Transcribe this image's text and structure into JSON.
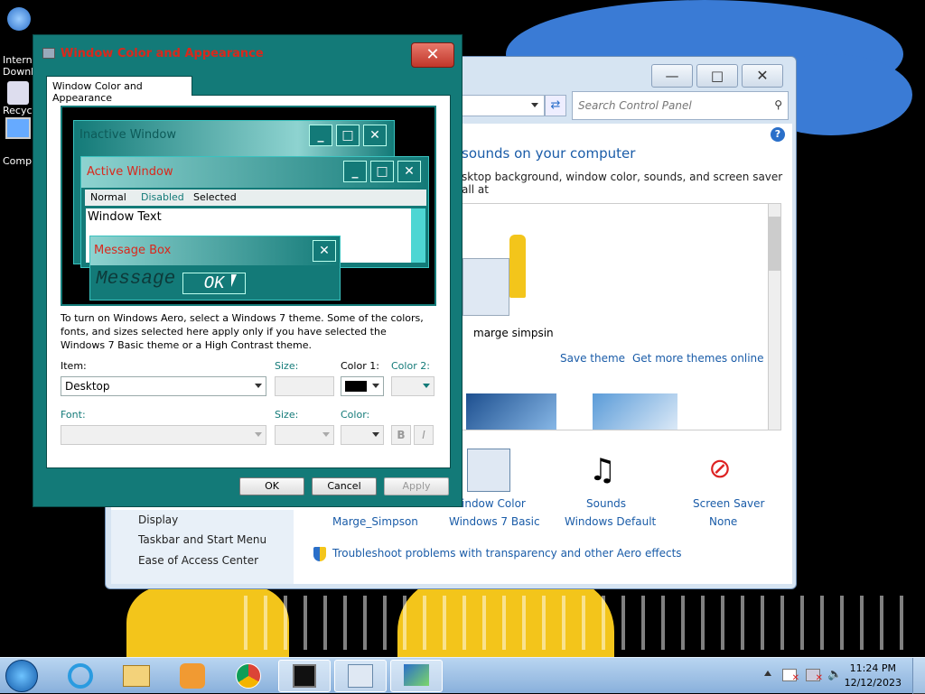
{
  "desktop": {
    "icons": [
      "Intern",
      "Downl",
      "Recyc",
      "Comp"
    ]
  },
  "control_panel": {
    "search_placeholder": "Search Control Panel",
    "heading": "sounds on your computer",
    "subheading": "sktop background, window color, sounds, and screen saver all at",
    "theme_name": "marge simpsin",
    "save_theme": "Save theme",
    "more_themes": "Get more themes online",
    "settings": [
      {
        "title": "indow Color",
        "value": "Windows 7 Basic"
      },
      {
        "title": "Sounds",
        "value": "Windows Default"
      },
      {
        "title": "Screen Saver",
        "value": "None"
      }
    ],
    "desktop_bg_value": "Marge_Simpson",
    "see_also": [
      "Display",
      "Taskbar and Start Menu",
      "Ease of Access Center"
    ],
    "troubleshoot": "Troubleshoot problems with transparency and other Aero effects"
  },
  "dialog": {
    "title": "Window Color and Appearance",
    "close_symbol": "✕",
    "tab": "Window Color and Appearance",
    "preview": {
      "inactive_window": "Inactive Window",
      "active_window": "Active Window",
      "menu": [
        "Normal",
        "Disabled",
        "Selected"
      ],
      "window_text": "Window Text",
      "message_box": "Message Box",
      "message_text": "Message Text",
      "ok": "OK"
    },
    "description": "To turn on Windows Aero, select a Windows 7 theme.  Some of the colors, fonts, and sizes selected here apply only if you have selected the Windows 7 Basic theme or a High Contrast theme.",
    "item_label": "Item:",
    "item_value": "Desktop",
    "size_label": "Size:",
    "color1_label": "Color 1:",
    "color2_label": "Color 2:",
    "font_label": "Font:",
    "font_size_label": "Size:",
    "color_label": "Color:",
    "bold_btn": "B",
    "italic_btn": "I",
    "ok": "OK",
    "cancel": "Cancel",
    "apply": "Apply"
  },
  "taskbar": {
    "time": "11:24 PM",
    "date": "12/12/2023"
  }
}
